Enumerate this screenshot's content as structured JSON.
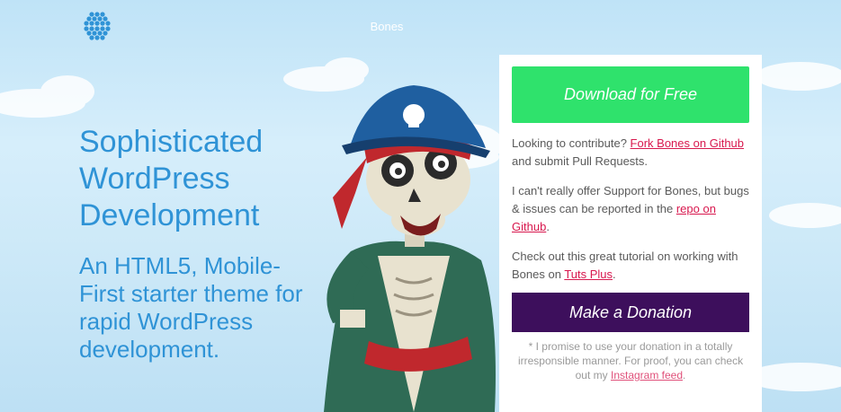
{
  "header": {
    "logo_icon": "hexagon-dots-logo",
    "brand": "Bones"
  },
  "hero": {
    "title": "Sophisticated WordPress Development",
    "subtitle": "An HTML5, Mobile-First starter theme for rapid WordPress development."
  },
  "illustration": "pirate-skeleton-mascot",
  "panel": {
    "download_label": "Download for Free",
    "contribute": {
      "before": "Looking to contribute? ",
      "link": "Fork Bones on Github",
      "after": " and submit Pull Requests."
    },
    "support": {
      "before": "I can't really offer Support for Bones, but bugs & issues can be reported in the ",
      "link": "repo on Github",
      "after": "."
    },
    "tutorial": {
      "before": "Check out this great tutorial on working with Bones on ",
      "link": "Tuts Plus",
      "after": "."
    },
    "donate_label": "Make a Donation",
    "note": {
      "before": "* I promise to use your donation in a totally irresponsible manner. For proof, you can check out my ",
      "link": "Instagram feed",
      "after": "."
    }
  },
  "colors": {
    "accent_blue": "#2f93d6",
    "download_green": "#2fe26c",
    "donate_purple": "#3d0f5c",
    "link_red": "#d8184e"
  }
}
